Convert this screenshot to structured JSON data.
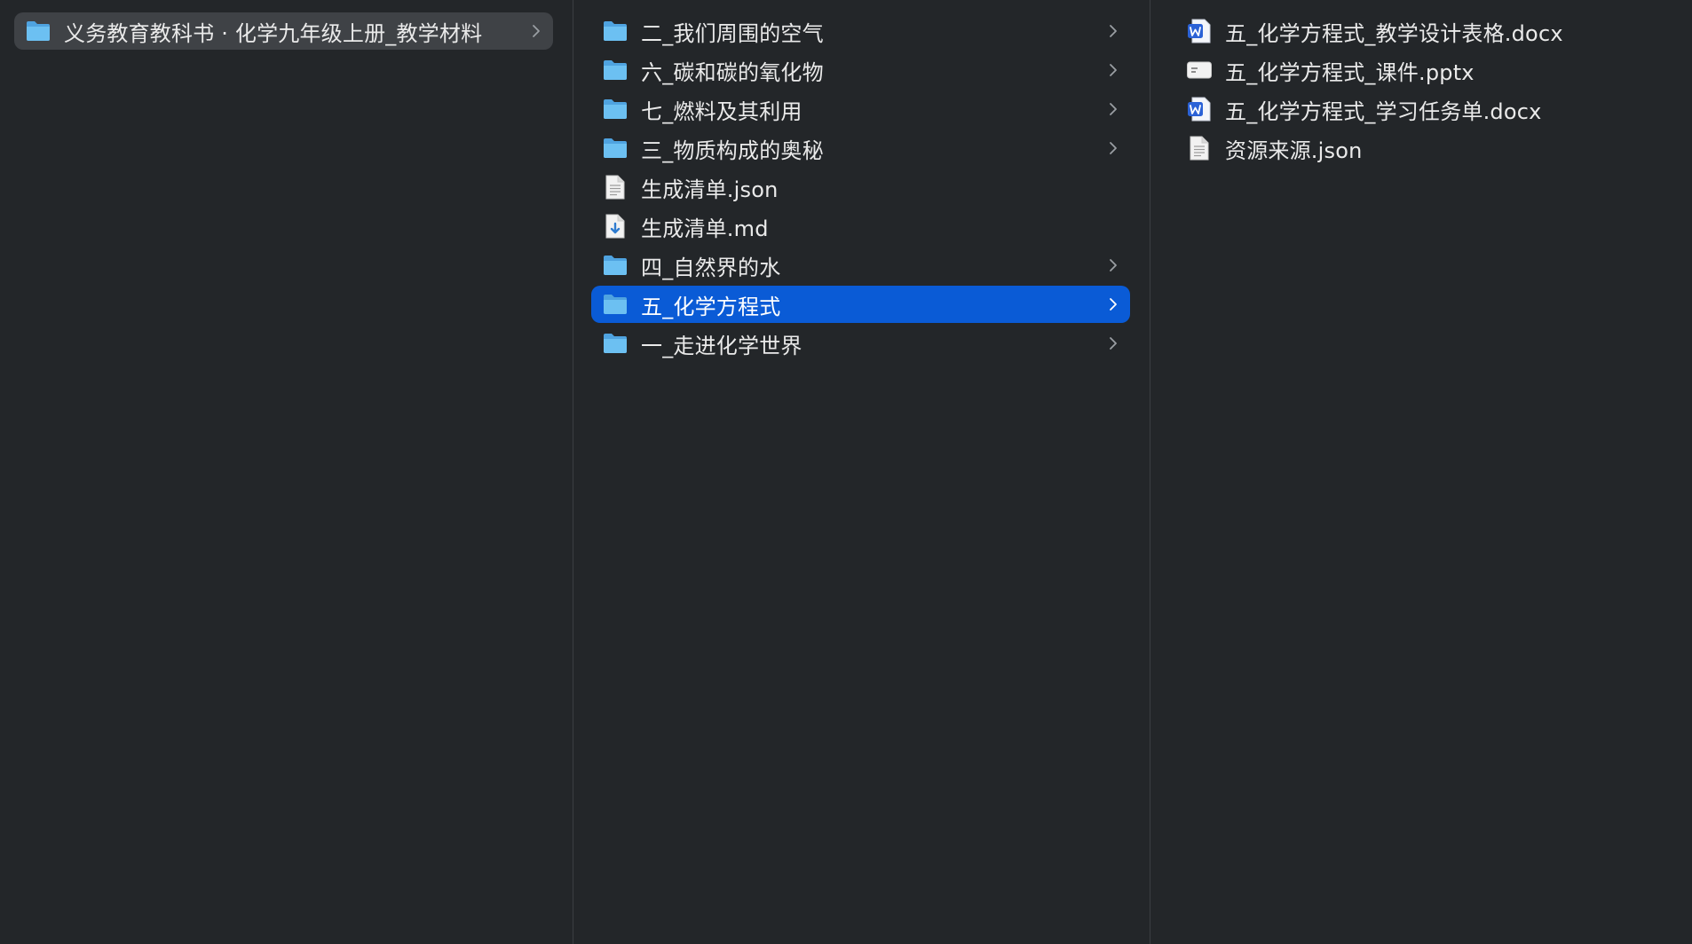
{
  "window": {
    "title": "义务教育教科书 · 化学九年级上册_教学材料"
  },
  "column1": {
    "items": [
      {
        "label": "义务教育教科书 · 化学九年级上册_教学材料",
        "icon": "folder-icon",
        "has_children": true,
        "state": "parent-selected"
      }
    ]
  },
  "column2": {
    "items": [
      {
        "label": "二_我们周围的空气",
        "icon": "folder-icon",
        "has_children": true
      },
      {
        "label": "六_碳和碳的氧化物",
        "icon": "folder-icon",
        "has_children": true
      },
      {
        "label": "七_燃料及其利用",
        "icon": "folder-icon",
        "has_children": true
      },
      {
        "label": "三_物质构成的奥秘",
        "icon": "folder-icon",
        "has_children": true
      },
      {
        "label": "生成清单.json",
        "icon": "document-icon",
        "has_children": false
      },
      {
        "label": "生成清单.md",
        "icon": "markdown-file-icon",
        "has_children": false
      },
      {
        "label": "四_自然界的水",
        "icon": "folder-icon",
        "has_children": true
      },
      {
        "label": "五_化学方程式",
        "icon": "folder-icon",
        "has_children": true,
        "state": "selected"
      },
      {
        "label": "一_走进化学世界",
        "icon": "folder-icon",
        "has_children": true
      }
    ]
  },
  "column3": {
    "items": [
      {
        "label": "五_化学方程式_教学设计表格.docx",
        "icon": "word-document-icon"
      },
      {
        "label": "五_化学方程式_课件.pptx",
        "icon": "presentation-file-icon"
      },
      {
        "label": "五_化学方程式_学习任务单.docx",
        "icon": "word-document-icon"
      },
      {
        "label": "资源来源.json",
        "icon": "document-icon"
      }
    ]
  },
  "colors": {
    "background": "#232629",
    "divider": "#3b3e42",
    "selection": "#0a5bd6",
    "parent_selection": "#3f4246",
    "folder": "#5fb6ee",
    "word_blue": "#2b62d6"
  }
}
